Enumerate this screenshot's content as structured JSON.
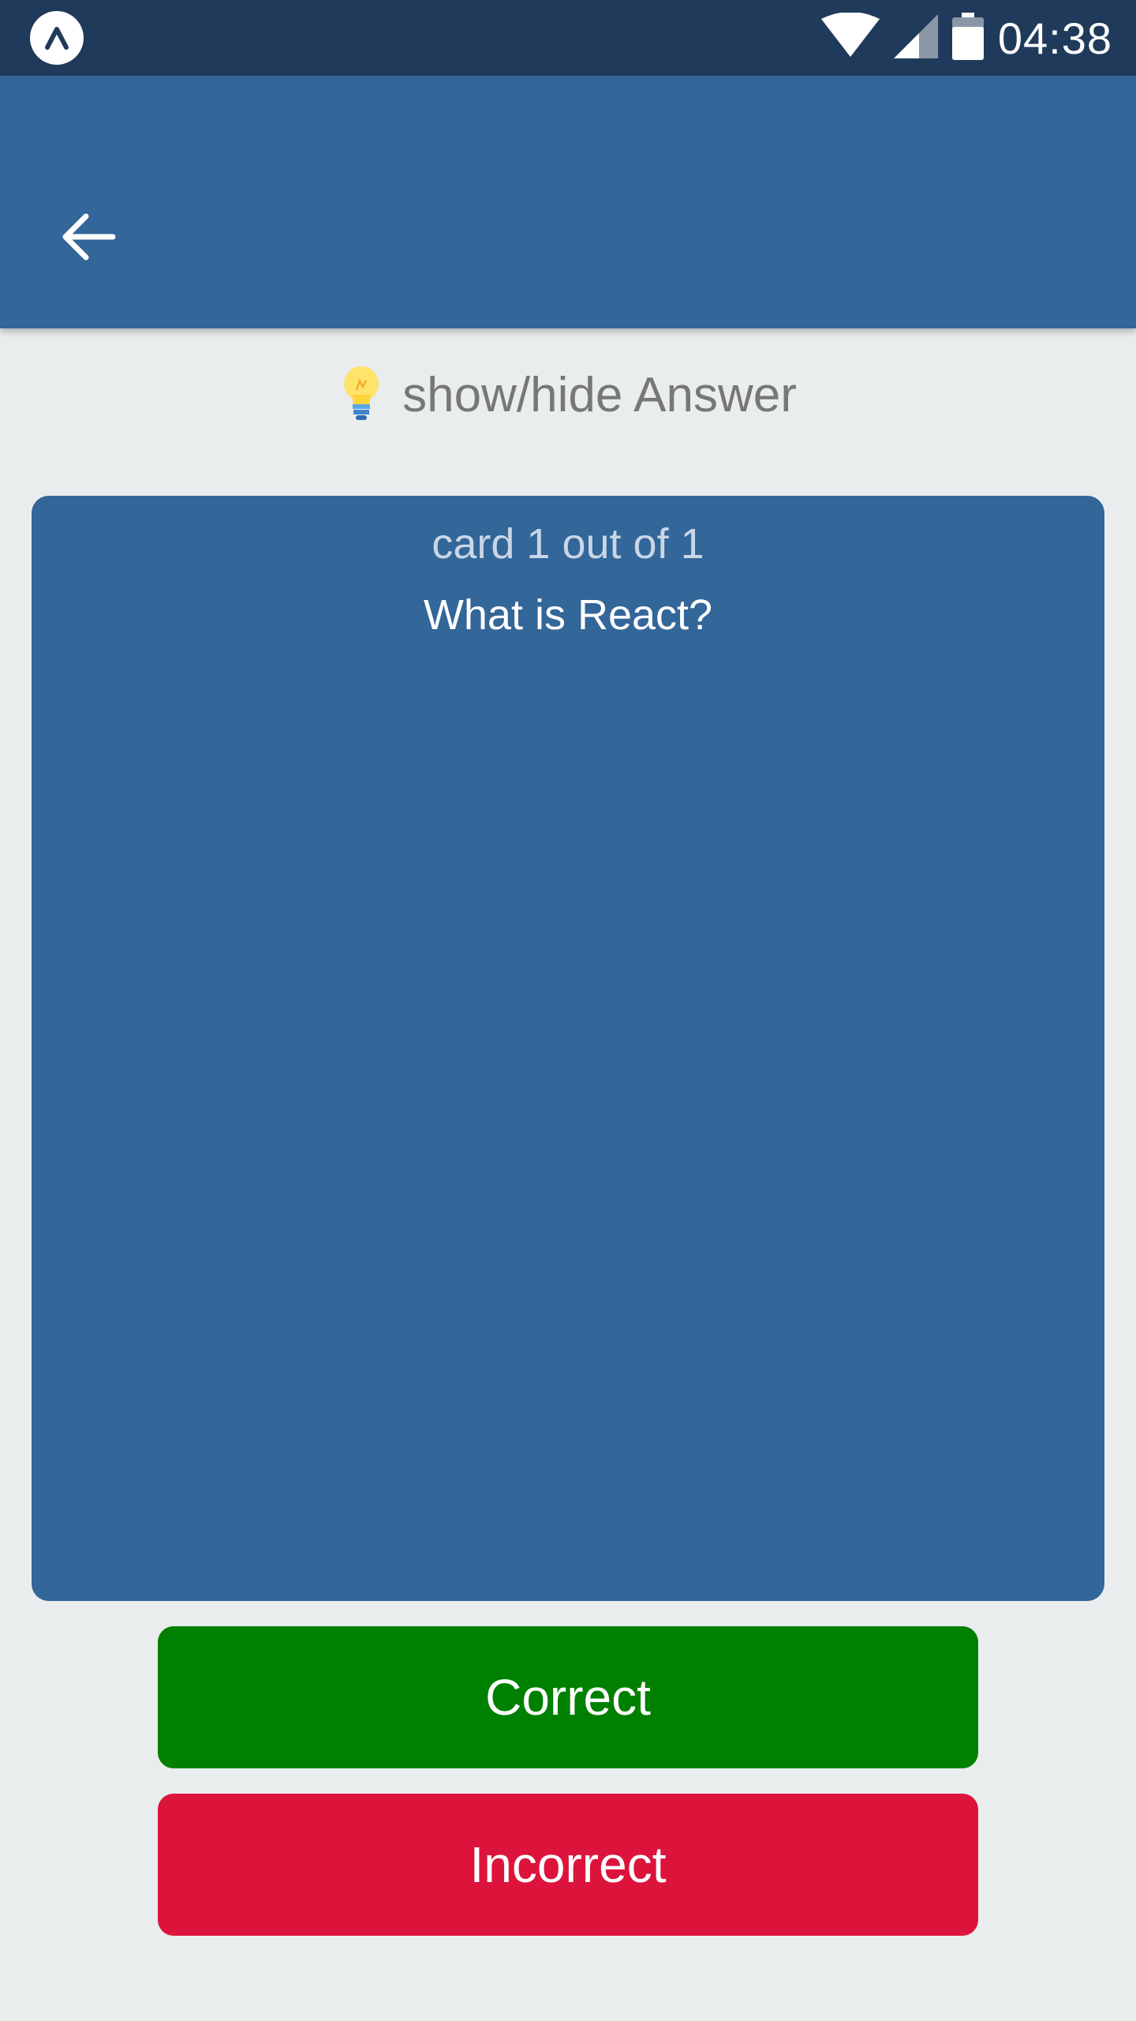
{
  "status_bar": {
    "time": "04:38",
    "icons": [
      "expo-icon",
      "wifi-icon",
      "cell-signal-icon",
      "battery-icon"
    ]
  },
  "app_bar": {
    "back_icon": "arrow-left-icon"
  },
  "answer_toggle": {
    "icon": "lightbulb-icon",
    "label": "show/hide Answer"
  },
  "card": {
    "counter": "card 1 out of 1",
    "question": "What is React?"
  },
  "buttons": {
    "correct_label": "Correct",
    "incorrect_label": "Incorrect"
  },
  "colors": {
    "status_bar": "#1f3a5a",
    "primary": "#336699",
    "background": "#e9edee",
    "correct": "#008000",
    "incorrect": "#dc143c"
  }
}
